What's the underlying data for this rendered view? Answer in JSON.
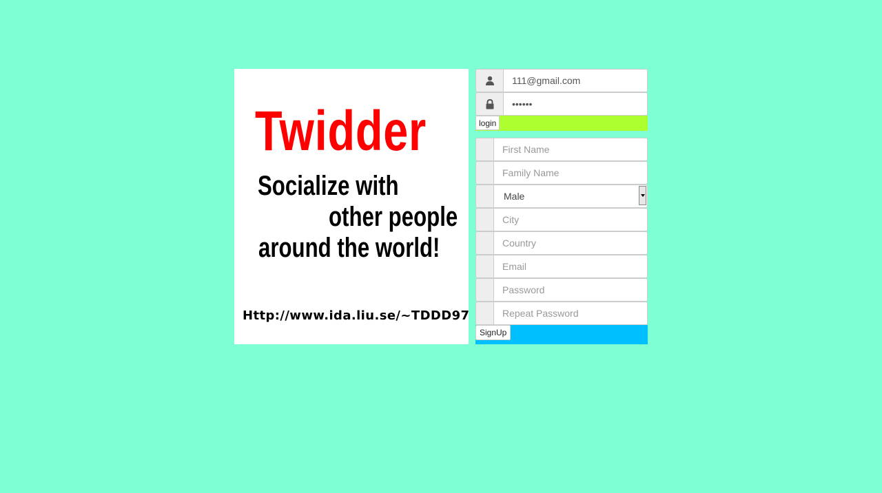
{
  "colors": {
    "page_background": "#7fffd4",
    "logo_background": "#ffffff",
    "logo_title": "#ff0000",
    "logo_text": "#000000",
    "login_bar": "#adff2f",
    "signup_bar": "#00bfff"
  },
  "logo": {
    "title": "Twidder",
    "tagline": [
      "Socialize with",
      "other people",
      "around the world!"
    ],
    "url": "Http://www.ida.liu.se/~TDDD97"
  },
  "login": {
    "email": {
      "icon": "user-icon",
      "value": "111@gmail.com"
    },
    "password": {
      "icon": "lock-icon",
      "value": "••••••"
    },
    "button_label": "login"
  },
  "signup": {
    "fields": [
      {
        "placeholder": "First Name"
      },
      {
        "placeholder": "Family Name"
      },
      {
        "gender_selected": "Male"
      },
      {
        "placeholder": "City"
      },
      {
        "placeholder": "Country"
      },
      {
        "placeholder": "Email"
      },
      {
        "placeholder": "Password"
      },
      {
        "placeholder": "Repeat Password"
      }
    ],
    "button_label": "SignUp"
  }
}
